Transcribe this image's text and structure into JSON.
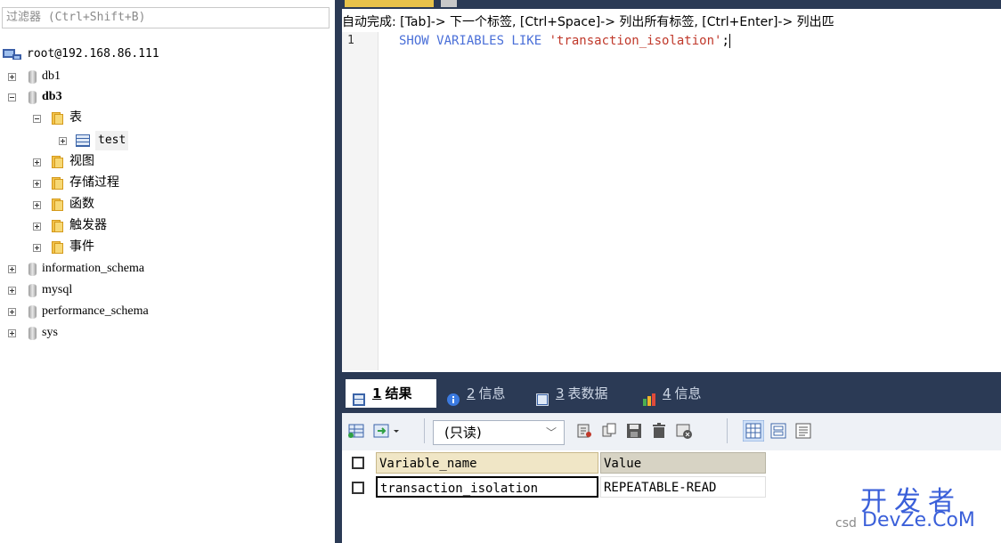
{
  "filter": {
    "placeholder": "过滤器 (Ctrl+Shift+B)"
  },
  "tree": {
    "server": "root@192.168.86.111",
    "db1": "db1",
    "db3": "db3",
    "tables_folder": "表",
    "table_test": "test",
    "views": "视图",
    "procs": "存储过程",
    "functions": "函数",
    "triggers": "触发器",
    "events": "事件",
    "info_schema": "information_schema",
    "mysql": "mysql",
    "perf_schema": "performance_schema",
    "sys": "sys"
  },
  "editor": {
    "autocomplete_hint": "自动完成: [Tab]-> 下一个标签, [Ctrl+Space]-> 列出所有标签, [Ctrl+Enter]-> 列出匹",
    "line_number": "1",
    "code_kw": "SHOW VARIABLES LIKE ",
    "code_str": "'transaction_isolation'",
    "code_end": ";"
  },
  "results": {
    "tabs": [
      {
        "num": "1",
        "label": "结果"
      },
      {
        "num": "2",
        "label": "信息"
      },
      {
        "num": "3",
        "label": "表数据"
      },
      {
        "num": "4",
        "label": "信息"
      }
    ],
    "readonly_label": "(只读)",
    "columns": [
      "Variable_name",
      "Value"
    ],
    "rows": [
      [
        "transaction_isolation",
        "REPEATABLE-READ"
      ]
    ]
  },
  "watermark": {
    "cn": "开发者",
    "en": "DevZe.CoM",
    "prefix": "csd"
  },
  "colors": {
    "accent": "#2b3a55",
    "keyword": "#4a6fd8",
    "string": "#c0392b",
    "watermark": "#3a5fd9"
  }
}
